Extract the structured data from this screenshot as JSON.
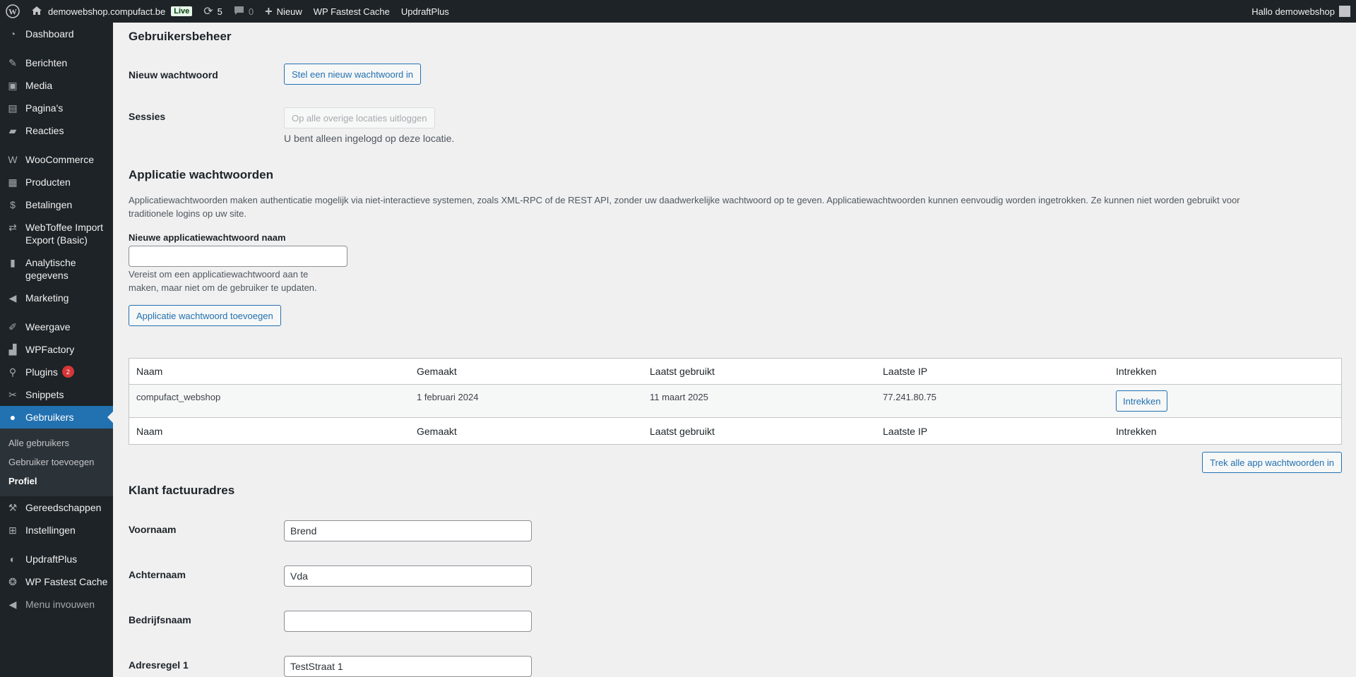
{
  "adminbar": {
    "site": "demowebshop.compufact.be",
    "live": "Live",
    "updates": "5",
    "comments": "0",
    "new": "Nieuw",
    "cache": "WP Fastest Cache",
    "updraft": "UpdraftPlus",
    "greeting": "Hallo demowebshop"
  },
  "sidebar": {
    "items": [
      {
        "label": "Dashboard",
        "icon": "dashboard-icon"
      },
      {
        "label": "Berichten",
        "icon": "pin-icon"
      },
      {
        "label": "Media",
        "icon": "media-icon"
      },
      {
        "label": "Pagina's",
        "icon": "page-icon"
      },
      {
        "label": "Reacties",
        "icon": "comment-icon"
      },
      {
        "label": "WooCommerce",
        "icon": "woocommerce-icon"
      },
      {
        "label": "Producten",
        "icon": "archive-icon"
      },
      {
        "label": "Betalingen",
        "icon": "money-icon"
      },
      {
        "label": "WebToffee Import Export (Basic)",
        "icon": "import-export-icon"
      },
      {
        "label": "Analytische gegevens",
        "icon": "chart-icon"
      },
      {
        "label": "Marketing",
        "icon": "megaphone-icon"
      },
      {
        "label": "Weergave",
        "icon": "brush-icon"
      },
      {
        "label": "WPFactory",
        "icon": "factory-icon"
      },
      {
        "label": "Plugins",
        "icon": "plugin-icon",
        "badge": "2"
      },
      {
        "label": "Snippets",
        "icon": "scissors-icon"
      },
      {
        "label": "Gebruikers",
        "icon": "user-icon"
      },
      {
        "label": "Gereedschappen",
        "icon": "wrench-icon"
      },
      {
        "label": "Instellingen",
        "icon": "settings-icon"
      },
      {
        "label": "UpdraftPlus",
        "icon": "updraft-icon"
      },
      {
        "label": "WP Fastest Cache",
        "icon": "cheetah-icon"
      },
      {
        "label": "Menu invouwen",
        "icon": "collapse-icon"
      }
    ],
    "submenu": [
      "Alle gebruikers",
      "Gebruiker toevoegen",
      "Profiel"
    ]
  },
  "account": {
    "title": "Gebruikersbeheer",
    "new_password_label": "Nieuw wachtwoord",
    "new_password_button": "Stel een nieuw wachtwoord in",
    "sessions_label": "Sessies",
    "sessions_button": "Op alle overige locaties uitloggen",
    "sessions_note": "U bent alleen ingelogd op deze locatie."
  },
  "app_passwords": {
    "title": "Applicatie wachtwoorden",
    "description_line1": "Applicatiewachtwoorden maken authenticatie mogelijk via niet-interactieve systemen, zoals XML-RPC of de REST API, zonder uw daadwerkelijke wachtwoord op te geven. Applicatiewachtwoorden kunnen eenvoudig worden ingetrokken. Ze kunnen niet worden gebruikt voor",
    "description_line2": "traditionele logins op uw site.",
    "name_label": "Nieuwe applicatiewachtwoord naam",
    "name_value": "",
    "help_line1": "Vereist om een applicatiewachtwoord aan te",
    "help_line2": "maken, maar niet om de gebruiker te updaten.",
    "add_button": "Applicatie wachtwoord toevoegen",
    "columns": [
      "Naam",
      "Gemaakt",
      "Laatst gebruikt",
      "Laatste IP",
      "Intrekken"
    ],
    "rows": [
      {
        "name": "compufact_webshop",
        "created": "1 februari 2024",
        "last_used": "11 maart 2025",
        "last_ip": "77.241.80.75",
        "revoke": "Intrekken"
      }
    ],
    "revoke_all_button": "Trek alle app wachtwoorden in"
  },
  "billing": {
    "title": "Klant factuuradres",
    "fields": [
      {
        "label": "Voornaam",
        "value": "Brend"
      },
      {
        "label": "Achternaam",
        "value": "Vda"
      },
      {
        "label": "Bedrijfsnaam",
        "value": ""
      },
      {
        "label": "Adresregel 1",
        "value": "TestStraat 1"
      }
    ]
  }
}
